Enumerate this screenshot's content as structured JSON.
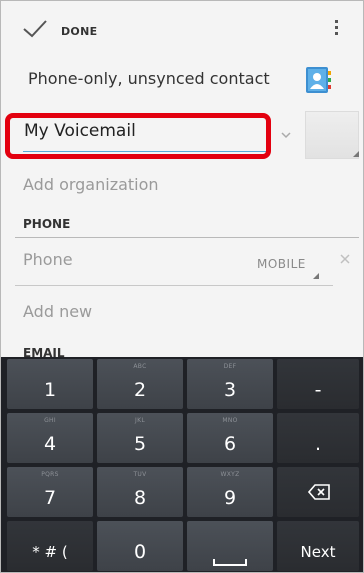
{
  "action_bar": {
    "done_label": "DONE",
    "check_icon": "checkmark-icon",
    "overflow_icon": "overflow-menu-icon"
  },
  "account": {
    "label": "Phone-only, unsynced contact",
    "icon": "contact-card-icon"
  },
  "name_field": {
    "value": "My Voicemail",
    "expand_icon": "chevron-down-icon",
    "highlight_color": "#e3000f"
  },
  "organization": {
    "label": "Add organization"
  },
  "phone_section": {
    "header": "PHONE",
    "phone_placeholder": "Phone",
    "phone_type": "MOBILE",
    "remove_icon": "close-icon",
    "add_new": "Add new"
  },
  "email_section": {
    "header": "EMAIL"
  },
  "keyboard": {
    "rows": [
      [
        {
          "main": "1",
          "sub": ""
        },
        {
          "main": "2",
          "sub": "ABC"
        },
        {
          "main": "3",
          "sub": "DEF"
        },
        {
          "main": "-",
          "sub": ""
        }
      ],
      [
        {
          "main": "4",
          "sub": "GHI"
        },
        {
          "main": "5",
          "sub": "JKL"
        },
        {
          "main": "6",
          "sub": "MNO"
        },
        {
          "main": ".",
          "sub": ""
        }
      ],
      [
        {
          "main": "7",
          "sub": "PQRS"
        },
        {
          "main": "8",
          "sub": "TUV"
        },
        {
          "main": "9",
          "sub": "WXYZ"
        },
        {
          "main": "",
          "sub": "",
          "icon": "backspace-icon"
        }
      ],
      [
        {
          "main": "* # (",
          "sub": ""
        },
        {
          "main": "0",
          "sub": ""
        },
        {
          "main": "",
          "sub": "",
          "icon": "spacebar-icon"
        },
        {
          "main": "Next",
          "sub": ""
        }
      ]
    ]
  }
}
